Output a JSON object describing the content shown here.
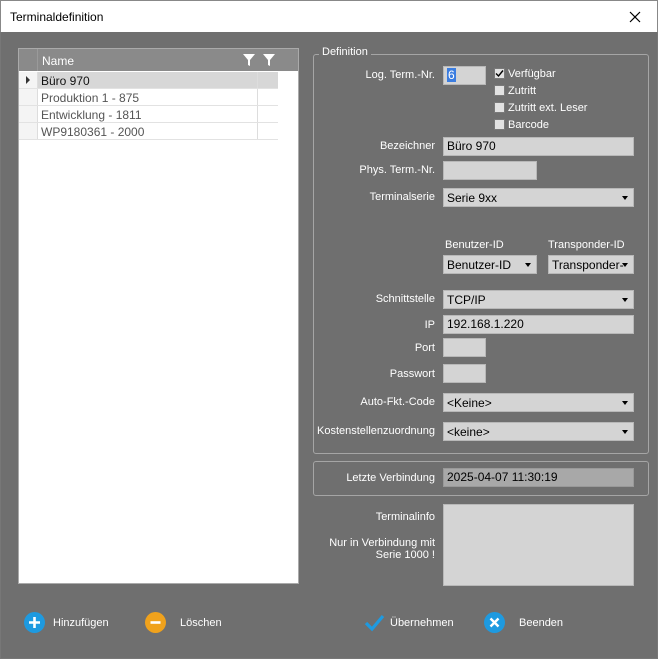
{
  "window": {
    "title": "Terminaldefinition"
  },
  "grid": {
    "column_name": "Name",
    "rows": [
      {
        "name": "Büro 970",
        "selected": true
      },
      {
        "name": "Produktion 1 - 875",
        "selected": false
      },
      {
        "name": "Entwicklung - 1811",
        "selected": false
      },
      {
        "name": "WP9180361 - 2000",
        "selected": false
      }
    ]
  },
  "definition": {
    "group_title": "Definition",
    "log_term_nr_label": "Log. Term.-Nr.",
    "log_term_nr_value": "6",
    "checkboxes": [
      {
        "label": "Verfügbar",
        "checked": true
      },
      {
        "label": "Zutritt",
        "checked": false
      },
      {
        "label": "Zutritt ext. Leser",
        "checked": false
      },
      {
        "label": "Barcode",
        "checked": false
      }
    ],
    "bezeichner_label": "Bezeichner",
    "bezeichner_value": "Büro 970",
    "phys_term_nr_label": "Phys. Term.-Nr.",
    "phys_term_nr_value": "",
    "terminalserie_label": "Terminalserie",
    "terminalserie_value": "Serie 9xx",
    "benutzer_id_label": "Benutzer-ID",
    "benutzer_id_value": "Benutzer-ID",
    "transponder_id_label": "Transponder-ID",
    "transponder_id_value": "Transponder-",
    "schnittstelle_label": "Schnittstelle",
    "schnittstelle_value": "TCP/IP",
    "ip_label": "IP",
    "ip_value": "192.168.1.220",
    "port_label": "Port",
    "port_value": "",
    "passwort_label": "Passwort",
    "passwort_value": "",
    "auto_fkt_label": "Auto-Fkt.-Code",
    "auto_fkt_value": "<Keine>",
    "kostenstellen_label": "Kostenstellenzuordnung",
    "kostenstellen_value": "<keine>"
  },
  "connection": {
    "letzte_label": "Letzte Verbindung",
    "letzte_value": "2025-04-07 11:30:19",
    "terminalinfo_label": "Terminalinfo",
    "terminalinfo_note": "Nur in Verbindung mit Serie 1000 !"
  },
  "buttons": {
    "add": "Hinzufügen",
    "delete": "Löschen",
    "apply": "Übernehmen",
    "exit": "Beenden"
  },
  "colors": {
    "background": "#6f6f6f",
    "add_icon": "#1e9ae0",
    "delete_icon": "#f0a21c",
    "apply_icon": "#1e9ae0",
    "exit_icon": "#1e9ae0"
  }
}
